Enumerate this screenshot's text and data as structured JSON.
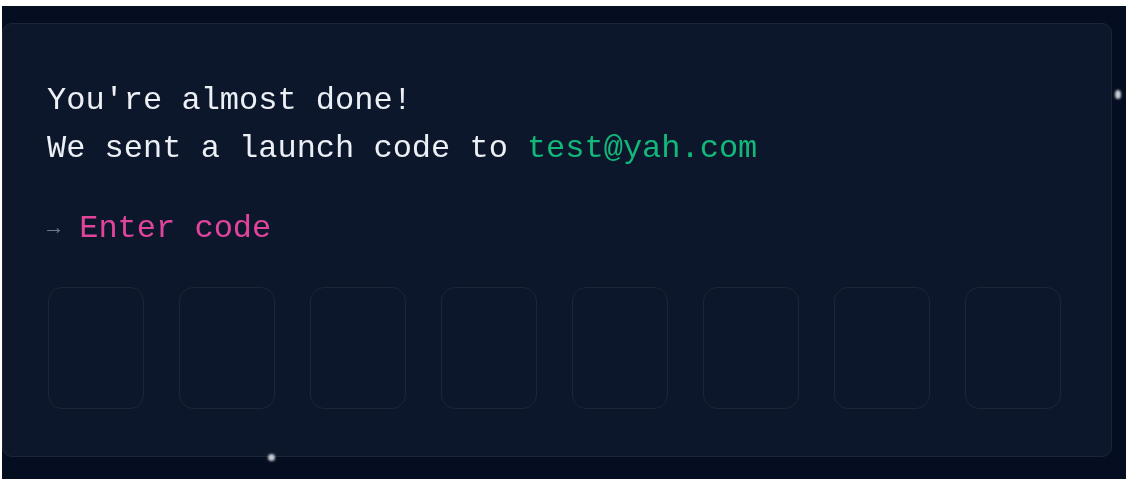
{
  "heading": "You're almost done!",
  "message": {
    "text": "We sent a launch code to",
    "email": "test@yah.com"
  },
  "prompt": {
    "arrow": "→",
    "label": "Enter code"
  },
  "code_fields": [
    {
      "kind": "digit"
    },
    {
      "kind": "digit"
    },
    {
      "kind": "digit"
    },
    {
      "kind": "digit"
    },
    {
      "kind": "digit"
    },
    {
      "kind": "digit"
    },
    {
      "kind": "digit"
    },
    {
      "kind": "digit"
    }
  ]
}
